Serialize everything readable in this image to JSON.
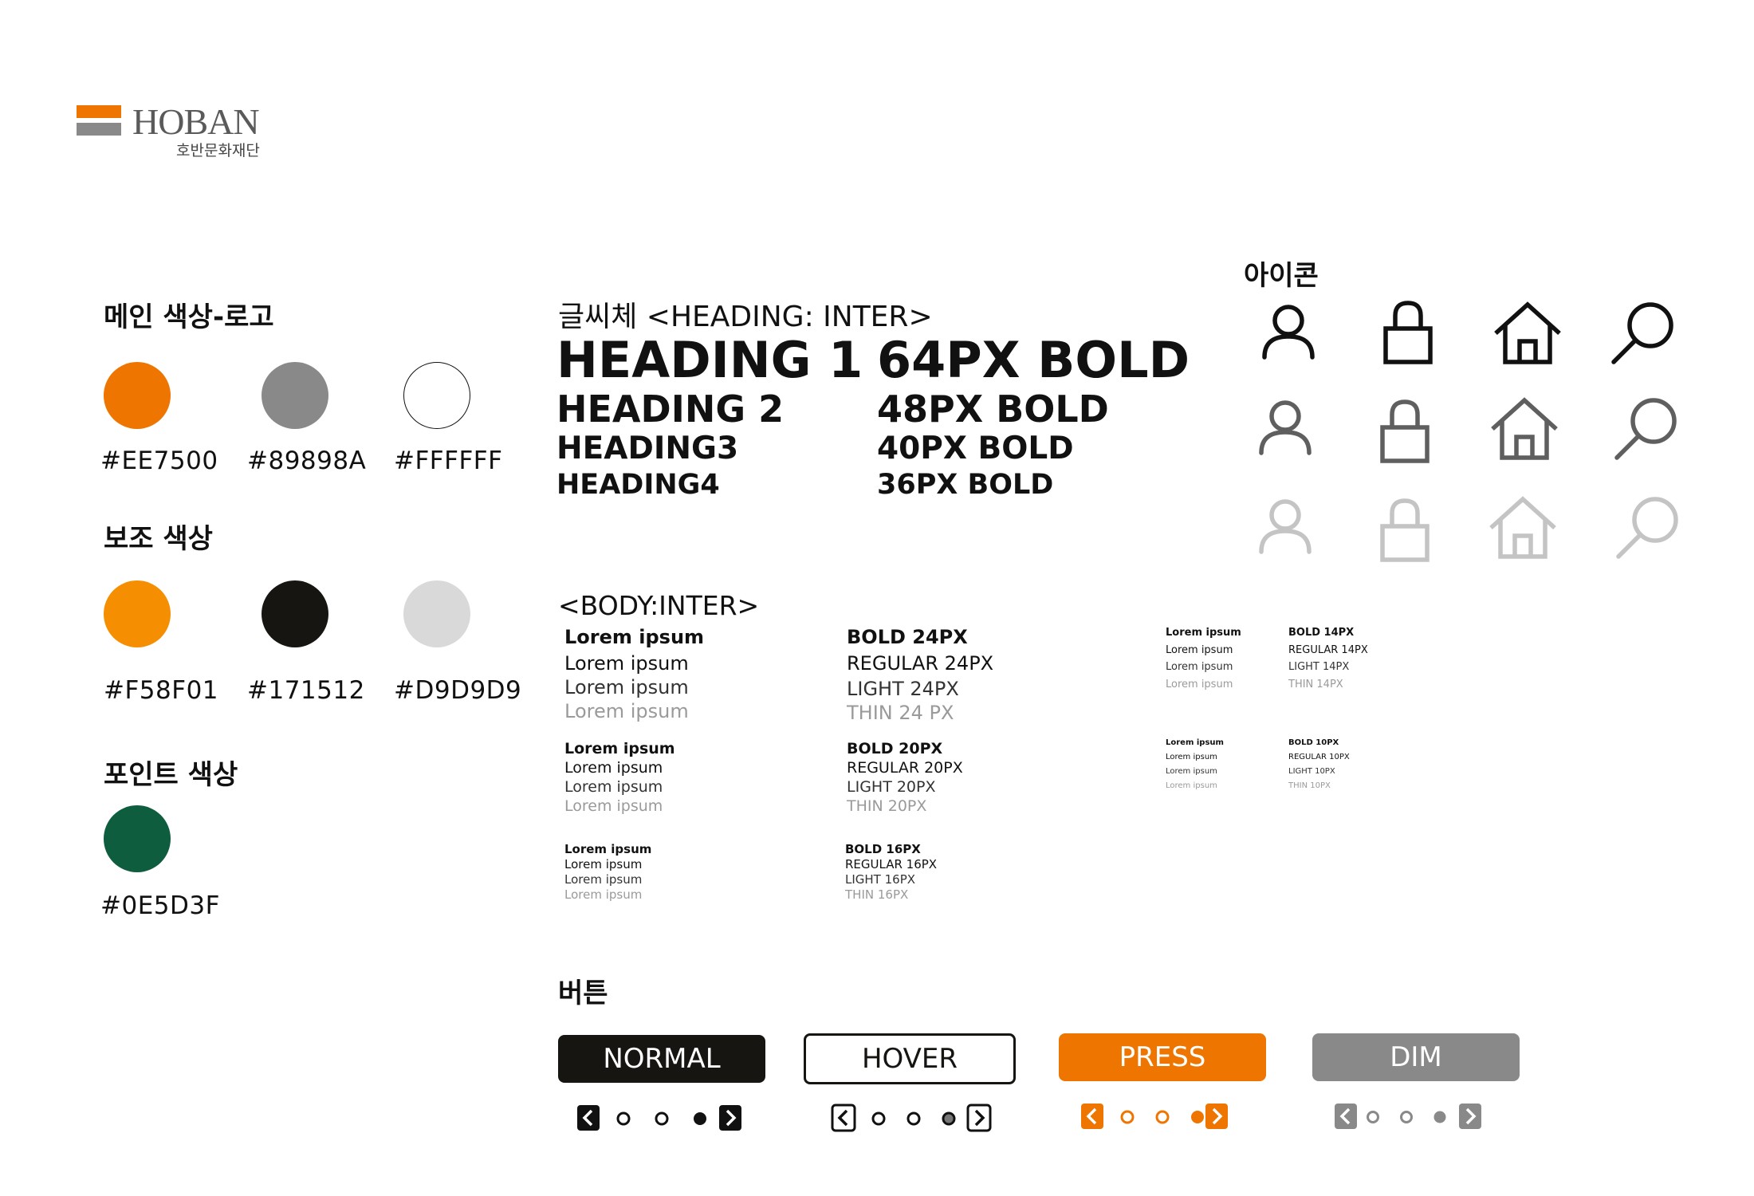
{
  "logo": {
    "wordmark": "HOBAN",
    "subtitle": "호반문화재단",
    "colors": {
      "top": "#EE7500",
      "bottom": "#89898A",
      "text": "#5A5A5A"
    }
  },
  "colors_section": {
    "main_title": "메인 색상-로고",
    "main": [
      {
        "hex": "#EE7500",
        "color": "#EE7500"
      },
      {
        "hex": "#89898A",
        "color": "#89898A"
      },
      {
        "hex": "#FFFFFF",
        "color": "#FFFFFF"
      }
    ],
    "sub_title": "보조 색상",
    "sub": [
      {
        "hex": "#F58F01",
        "color": "#F58F01"
      },
      {
        "hex": "#171512",
        "color": "#171512"
      },
      {
        "hex": "#D9D9D9",
        "color": "#D9D9D9"
      }
    ],
    "point_title": "포인트 색상",
    "point": [
      {
        "hex": "#0E5D3F",
        "color": "#0E5D3F"
      }
    ]
  },
  "typography": {
    "title": "글씨체 <HEADING: INTER>",
    "headings": [
      {
        "name": "HEADING 1",
        "spec": "64PX BOLD"
      },
      {
        "name": "HEADING 2",
        "spec": "48PX BOLD"
      },
      {
        "name": "HEADING3",
        "spec": "40PX BOLD"
      },
      {
        "name": "HEADING4",
        "spec": "36PX BOLD"
      }
    ],
    "body_title": "<BODY:INTER>",
    "sample": "Lorem ipsum",
    "body_24": [
      "BOLD 24PX",
      "REGULAR 24PX",
      "LIGHT 24PX",
      "THIN 24 PX"
    ],
    "body_20": [
      "BOLD 20PX",
      "REGULAR 20PX",
      "LIGHT 20PX",
      "THIN 20PX"
    ],
    "body_16": [
      "BOLD 16PX",
      "REGULAR 16PX",
      "LIGHT 16PX",
      "THIN 16PX"
    ],
    "body_14": [
      "BOLD 14PX",
      "REGULAR 14PX",
      "LIGHT 14PX",
      "THIN 14PX"
    ],
    "body_10": [
      "BOLD 10PX",
      "REGULAR 10PX",
      "LIGHT 10PX",
      "THIN 10PX"
    ]
  },
  "icons": {
    "title": "아이콘",
    "names": [
      "user-icon",
      "lock-icon",
      "home-icon",
      "search-icon"
    ],
    "row_colors": [
      "#111111",
      "#5F5F5F",
      "#C4C4C4"
    ]
  },
  "buttons": {
    "title": "버튼",
    "normal": {
      "label": "NORMAL",
      "bg": "#171512",
      "fg": "#FFFFFF"
    },
    "hover": {
      "label": "HOVER",
      "bg": "#FFFFFF",
      "fg": "#171512"
    },
    "press": {
      "label": "PRESS",
      "bg": "#EE7500",
      "fg": "#FFFFFF"
    },
    "dim": {
      "label": "DIM",
      "bg": "#89898A",
      "fg": "#FFFFFF"
    }
  },
  "pagers": {
    "normal_color": "#111111",
    "hover_color": "#333333",
    "press_color": "#EE7500",
    "dim_color": "#89898A"
  }
}
